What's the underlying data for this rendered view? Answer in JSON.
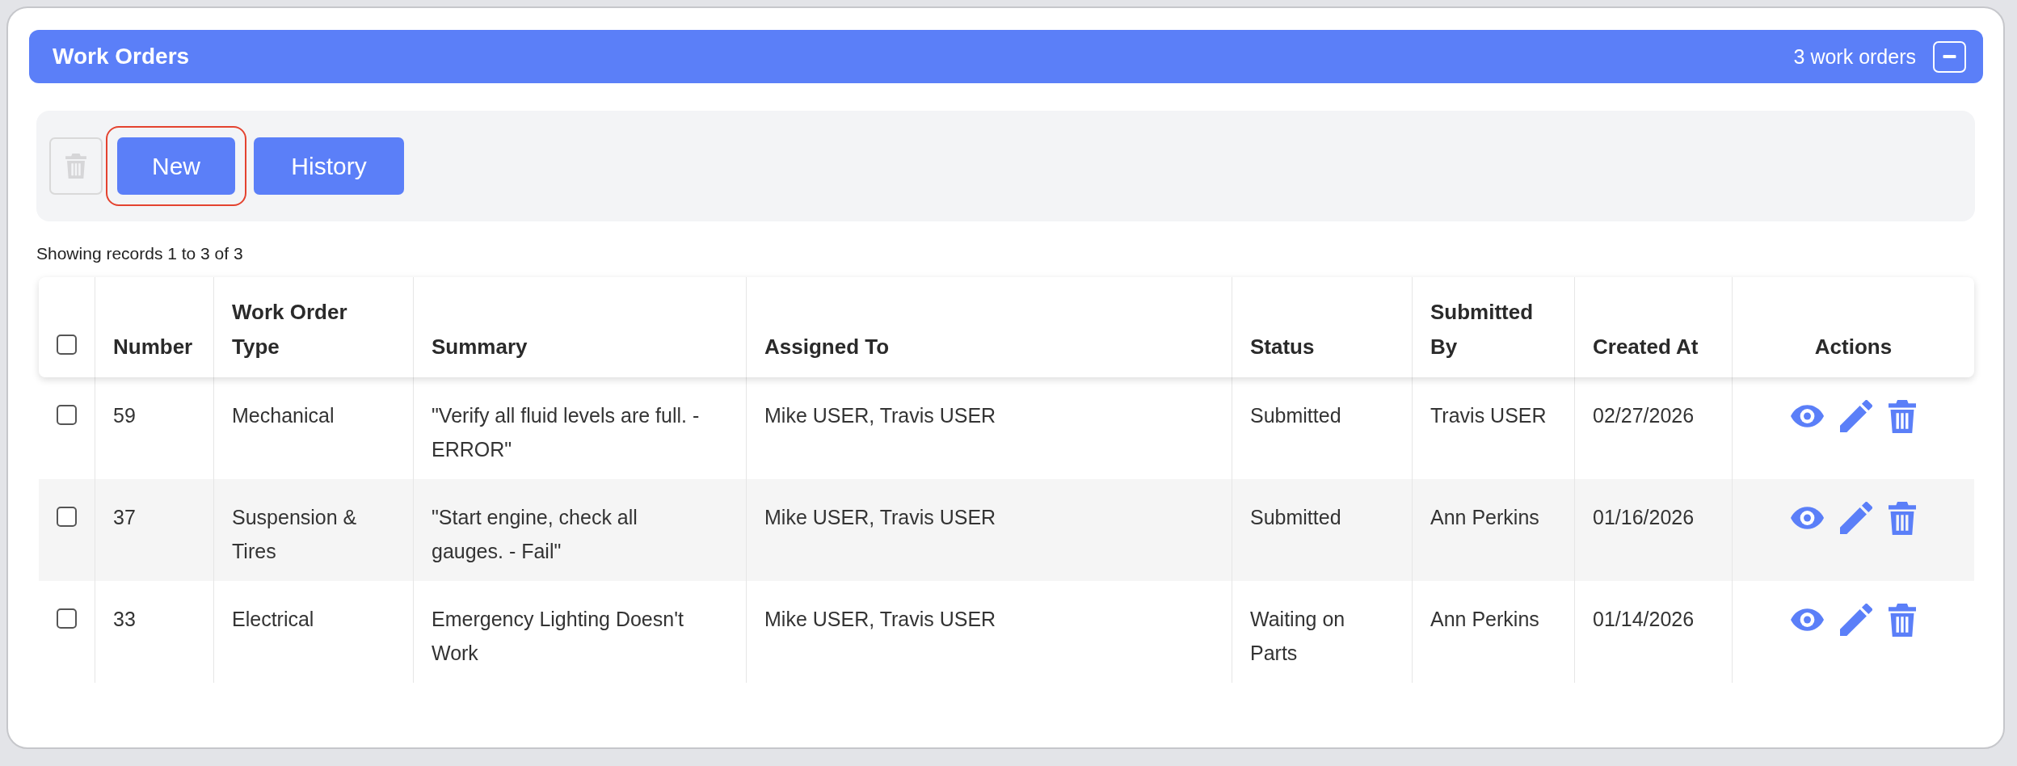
{
  "panel": {
    "title": "Work Orders",
    "count": "3 work orders",
    "expanded": true
  },
  "toolbar": {
    "delete_button": {
      "disabled": true
    },
    "buttons": [
      {
        "label": "New",
        "highlighted": true
      },
      {
        "label": "History",
        "highlighted": false
      }
    ]
  },
  "records_info": "Showing records 1 to 3 of 3",
  "table": {
    "select_all": {
      "checked": false
    },
    "columns": [
      {
        "label": "Number",
        "kind": "text"
      },
      {
        "label": "Work Order Type",
        "kind": "text"
      },
      {
        "label": "Summary",
        "kind": "text"
      },
      {
        "label": "Assigned To",
        "kind": "text"
      },
      {
        "label": "Status",
        "kind": "text"
      },
      {
        "label": "Submitted By",
        "kind": "text"
      },
      {
        "label": "Created At",
        "kind": "text"
      },
      {
        "label": "Actions",
        "kind": "actions"
      }
    ],
    "rows": [
      {
        "checked": false,
        "cells": [
          "59",
          "Mechanical",
          "\"Verify all fluid levels are full. - ERROR\"",
          "Mike USER, Travis USER",
          "Submitted",
          "Travis USER",
          "02/27/2026"
        ]
      },
      {
        "checked": false,
        "cells": [
          "37",
          "Suspension & Tires",
          "\"Start engine, check all gauges. - Fail\"",
          "Mike USER, Travis USER",
          "Submitted",
          "Ann Perkins",
          "01/16/2026"
        ]
      },
      {
        "checked": false,
        "cells": [
          "33",
          "Electrical",
          "Emergency Lighting Doesn't Work",
          "Mike USER, Travis USER",
          "Waiting on Parts",
          "Ann Perkins",
          "01/14/2026"
        ]
      }
    ]
  }
}
